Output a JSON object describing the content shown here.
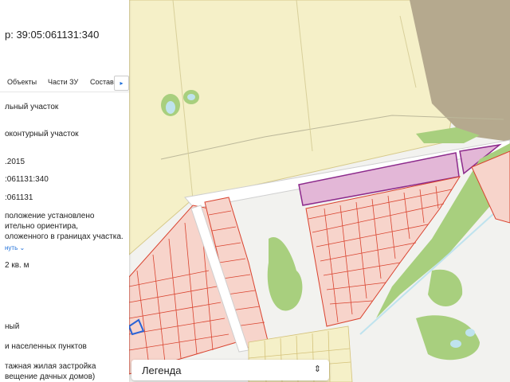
{
  "panel": {
    "cadastral_title": "р: 39:05:061131:340",
    "tabs": [
      "Объекты",
      "Части ЗУ",
      "Состав"
    ],
    "info_lines": [
      "льный участок",
      "оконтурный участок",
      ".2015",
      ":061131:340",
      ":061131",
      "положение установлено",
      "ительно ориентира,",
      "оложенного в границах участка.",
      "2 кв. м",
      "ный",
      "и населенных пунктов",
      "тажная жилая застройка",
      "вещение дачных домов)"
    ],
    "more_link": "нуть"
  },
  "legend": {
    "label": "Легенда"
  },
  "colors": {
    "yellow_zone": "#f5f0c8",
    "parcel_fill": "#f7d4cb",
    "parcel_stroke": "#d9432f",
    "highlight_fill": "#e3b7d7",
    "highlight_stroke": "#8c2a8c",
    "green": "#a8cf7e",
    "forest": "#b2a58b",
    "water": "#bfe3ee",
    "link": "#1e6fd9"
  },
  "icons": {
    "tab_arrow": "caret-right-icon",
    "more": "chevron-down-icon",
    "legend": "up-down-chevron-icon"
  }
}
